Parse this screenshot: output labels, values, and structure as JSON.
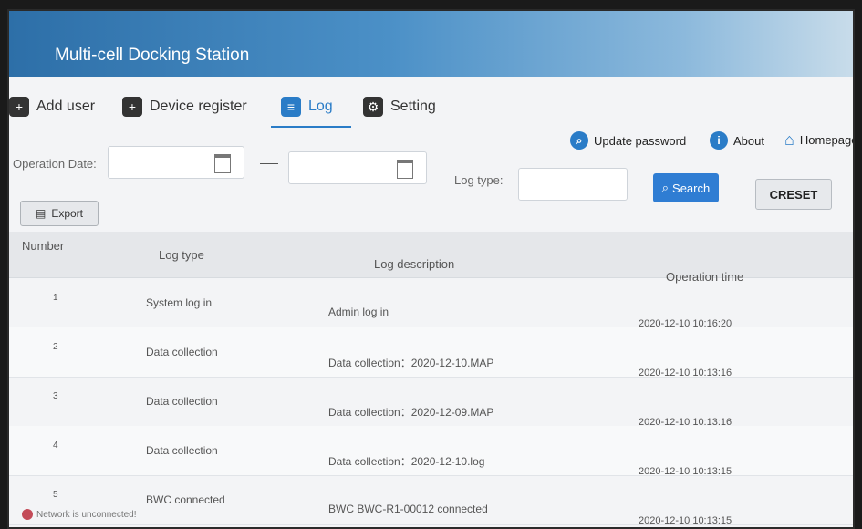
{
  "app": {
    "title": "Multi-cell Docking Station"
  },
  "nav": {
    "tabs": [
      {
        "label": "Add user",
        "icon": "add-user-icon",
        "active": false
      },
      {
        "label": "Device register",
        "icon": "device-register-icon",
        "active": false
      },
      {
        "label": "Log",
        "icon": "log-icon",
        "active": true
      },
      {
        "label": "Setting",
        "icon": "gear-icon",
        "active": false
      }
    ],
    "right_links": [
      {
        "label": "Update password",
        "icon": "search-icon"
      },
      {
        "label": "About",
        "icon": "info-icon"
      },
      {
        "label": "Homepage",
        "icon": "home-icon"
      }
    ],
    "accent_color": "#2a7cc7"
  },
  "filter": {
    "operation_date_label": "Operation Date:",
    "log_type_label": "Log type:",
    "start_date_value": "",
    "end_date_value": "",
    "log_type_value": "",
    "search_label": "Search",
    "reset_label": "RESET",
    "export_label": "Export"
  },
  "table": {
    "headers": [
      "Number",
      "Log type",
      "Log description",
      "Operation time"
    ],
    "rows": [
      {
        "number": "1",
        "log_type": "System log in",
        "description": "Admin log in",
        "time": "2020-12-10 10:16:20"
      },
      {
        "number": "2",
        "log_type": "Data collection",
        "description": "Data collection：2020-12-10.MAP",
        "time": "2020-12-10 10:13:16"
      },
      {
        "number": "3",
        "log_type": "Data collection",
        "description": "Data collection：2020-12-09.MAP",
        "time": "2020-12-10 10:13:16"
      },
      {
        "number": "4",
        "log_type": "Data collection",
        "description": "Data collection：2020-12-10.log",
        "time": "2020-12-10 10:13:15"
      },
      {
        "number": "5",
        "log_type": "BWC connected",
        "description": "BWC BWC-R1-00012 connected",
        "time": "2020-12-10 10:13:15"
      }
    ]
  },
  "status": {
    "text": "Network is unconnected!",
    "color": "#c34b58"
  }
}
